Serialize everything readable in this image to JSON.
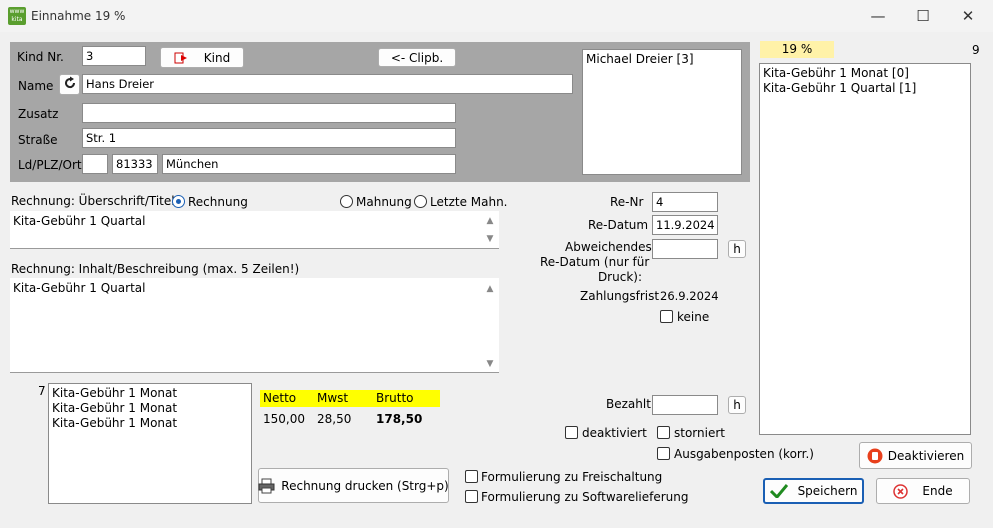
{
  "window": {
    "title": "Einnahme 19 %",
    "icon_name": "app-icon",
    "icon_text": "www kita"
  },
  "controls": {
    "minimize": "—",
    "maximize": "☐",
    "close": "✕"
  },
  "child": {
    "kind_nr_label": "Kind Nr.",
    "kind_nr_value": "3",
    "kind_button": "Kind",
    "clipb_button": "<- Clipb.",
    "name_label": "Name",
    "name_value": "Hans Dreier",
    "zusatz_label": "Zusatz",
    "zusatz_value": "",
    "strasse_label": "Straße",
    "strasse_value": "Str. 1",
    "ort_label": "Ld/PLZ/Ort",
    "land_value": "",
    "plz_value": "81333",
    "ort_value": "München",
    "list": [
      "Michael Dreier [3]"
    ]
  },
  "tax": {
    "rate_label": "19 %",
    "count": "9",
    "items": [
      "Kita-Gebühr 1 Monat [0]",
      "Kita-Gebühr 1 Quartal [1]"
    ]
  },
  "invoice": {
    "title_label": "Rechnung: Überschrift/Titel",
    "radio_rechnung": "Rechnung",
    "radio_mahnung": "Mahnung",
    "radio_letzte": "Letzte Mahn.",
    "title_value": "Kita-Gebühr 1 Quartal",
    "content_label": "Rechnung: Inhalt/Beschreibung (max. 5 Zeilen!)",
    "content_value": "Kita-Gebühr 1 Quartal"
  },
  "meta": {
    "re_nr_label": "Re-Nr",
    "re_nr_value": "4",
    "re_datum_label": "Re-Datum",
    "re_datum_value": "11.9.2024",
    "abw_label_1": "Abweichendes",
    "abw_label_2": "Re-Datum (nur für",
    "abw_label_3": "Druck):",
    "abw_value": "",
    "h_button": "h",
    "zahlungsfrist_label": "Zahlungsfrist",
    "zahlungsfrist_value": "26.9.2024",
    "keine_label": "keine",
    "bezahlt_label": "Bezahlt",
    "bezahlt_value": ""
  },
  "items": {
    "count": "7",
    "list": [
      "Kita-Gebühr 1 Monat",
      "Kita-Gebühr 1 Monat",
      "Kita-Gebühr 1 Monat"
    ]
  },
  "amounts": {
    "netto_label": "Netto",
    "mwst_label": "Mwst",
    "brutto_label": "Brutto",
    "netto": "150,00",
    "mwst": "28,50",
    "brutto": "178,50"
  },
  "options": {
    "deaktiviert": "deaktiviert",
    "storniert": "storniert",
    "ausgabenposten": "Ausgabenposten (korr.)",
    "freischaltung": "Formulierung zu Freischaltung",
    "softwarelieferung": "Formulierung zu Softwarelieferung"
  },
  "buttons": {
    "print": "Rechnung drucken (Strg+p)",
    "deaktivieren": "Deaktivieren",
    "speichern": "Speichern",
    "ende": "Ende"
  },
  "colors": {
    "panel": "#a6a6a6",
    "highlight": "#ffff00",
    "rate_bg": "#fff2a8"
  }
}
